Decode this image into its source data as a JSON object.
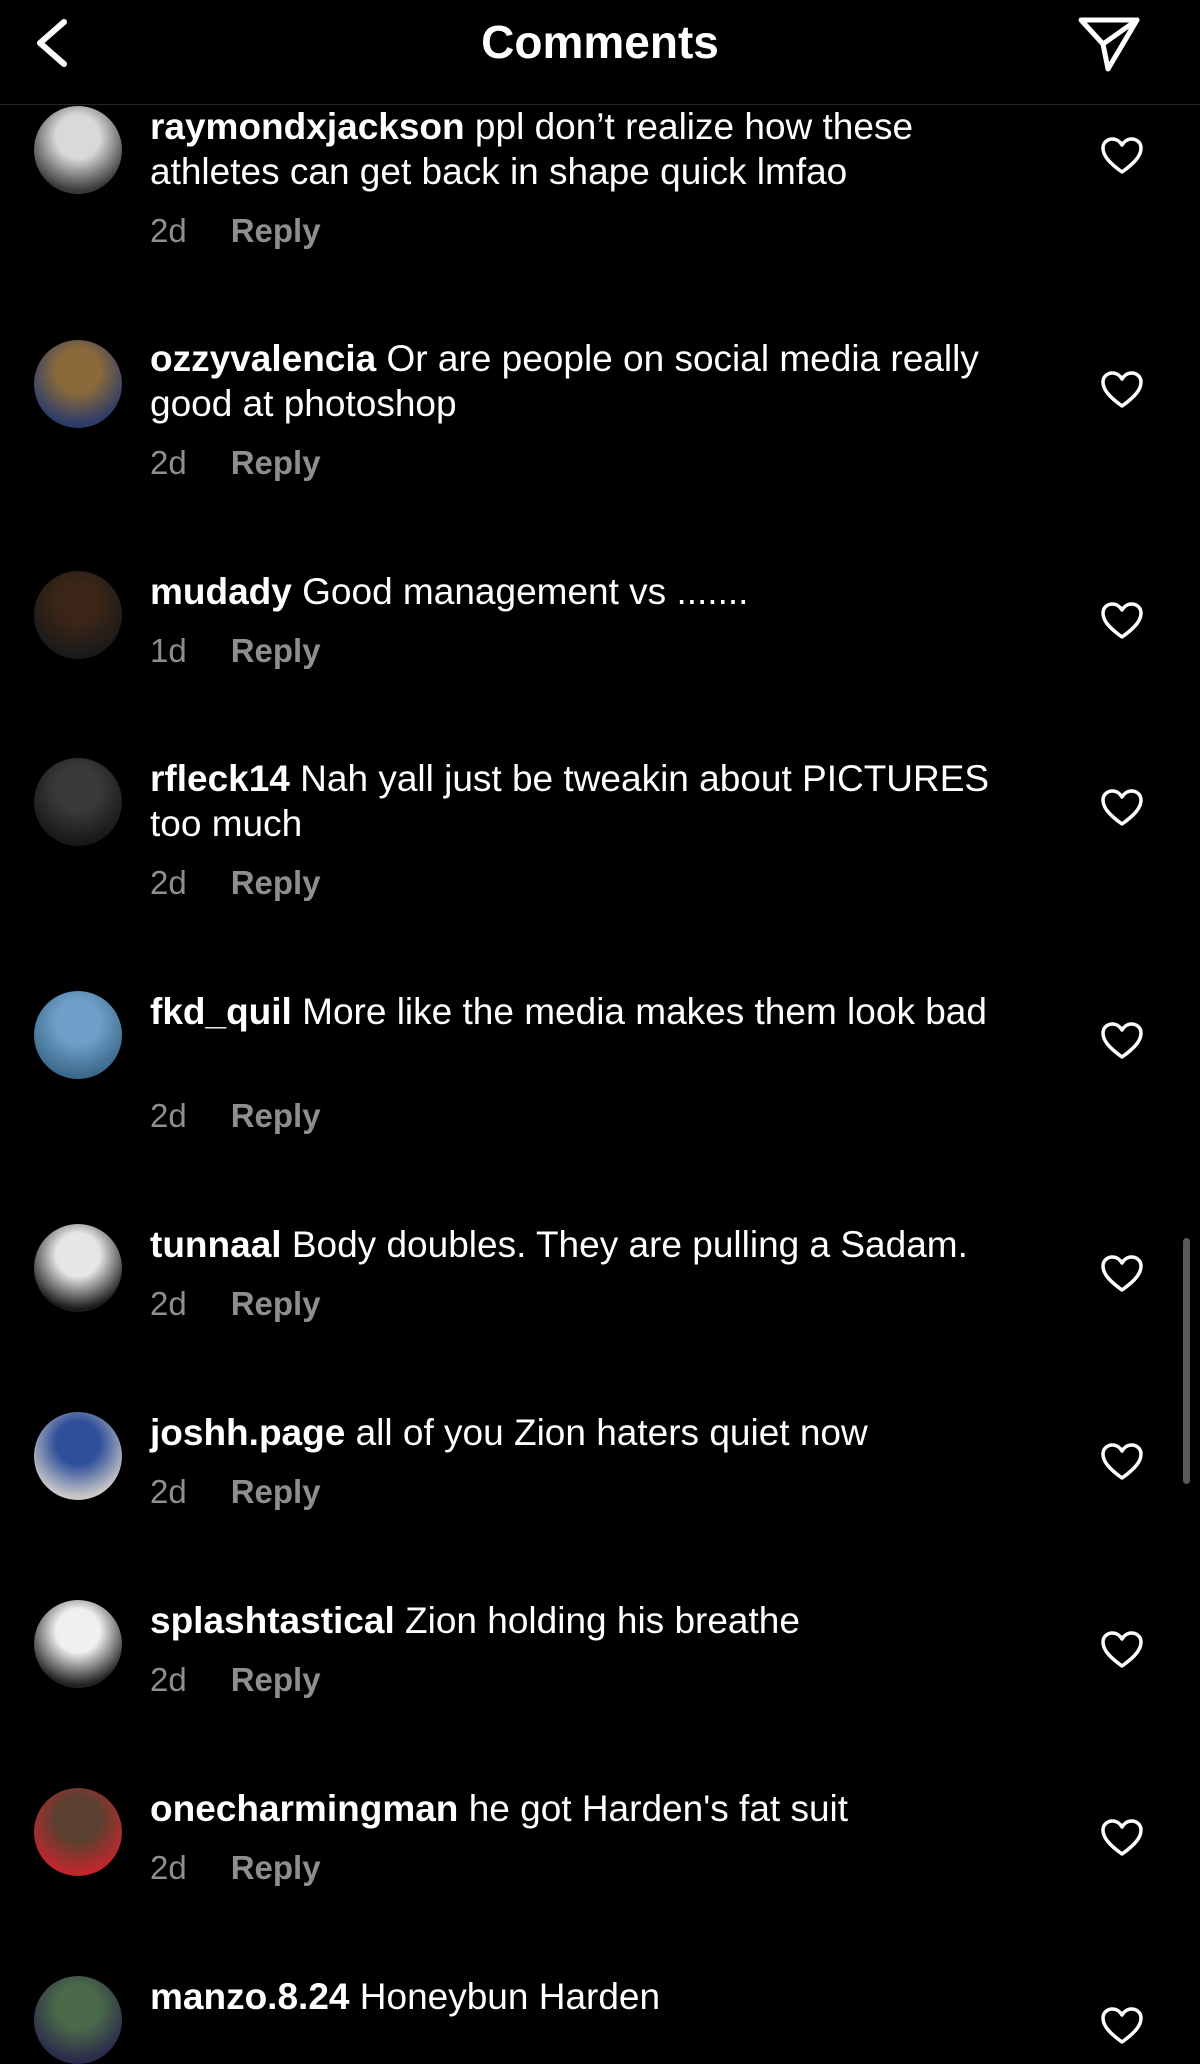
{
  "header": {
    "title": "Comments",
    "back_icon": "chevron-left-icon",
    "share_icon": "paper-plane-icon"
  },
  "reply_label": "Reply",
  "comments": [
    {
      "username": "raymondxjackson",
      "text": "ppl don’t realize how these athletes can get back in shape quick lmfao",
      "time": "2d",
      "avatar_colors": [
        "#d9d9d9",
        "#3a3a3a"
      ]
    },
    {
      "username": "ozzyvalencia",
      "text": "Or are people on social media really good at photoshop",
      "time": "2d",
      "avatar_colors": [
        "#8a6a3a",
        "#2b3b6a"
      ]
    },
    {
      "username": "mudady",
      "text": "Good management vs .......",
      "time": "1d",
      "avatar_colors": [
        "#3a2516",
        "#1a1a1a"
      ]
    },
    {
      "username": "rfleck14",
      "text": "Nah yall just be tweakin about PICTURES too much",
      "time": "2d",
      "avatar_colors": [
        "#3a3a3a",
        "#181818"
      ]
    },
    {
      "username": "fkd_quil",
      "text": "More like the media makes them look bad",
      "time": "2d",
      "avatar_colors": [
        "#6f9fc8",
        "#3c6a8c"
      ]
    },
    {
      "username": "tunnaal",
      "text": "Body doubles. They are pulling a Sadam.",
      "time": "2d",
      "avatar_colors": [
        "#e6e6e6",
        "#1b1b1b"
      ]
    },
    {
      "username": "joshh.page",
      "text": "all of you Zion haters quiet now",
      "time": "2d",
      "avatar_colors": [
        "#2f4f9a",
        "#c8c8c8"
      ]
    },
    {
      "username": "splashtastical",
      "text": "Zion holding his breathe",
      "time": "2d",
      "avatar_colors": [
        "#f0f0f0",
        "#222222"
      ]
    },
    {
      "username": "onecharmingman",
      "text": "he got Harden's fat suit",
      "time": "2d",
      "avatar_colors": [
        "#5a4030",
        "#c0272d"
      ]
    },
    {
      "username": "manzo.8.24",
      "text": "Honeybun Harden",
      "time": "",
      "avatar_colors": [
        "#4a6a4a",
        "#2a2a4a"
      ]
    }
  ],
  "heart_icon": "heart-outline-icon"
}
